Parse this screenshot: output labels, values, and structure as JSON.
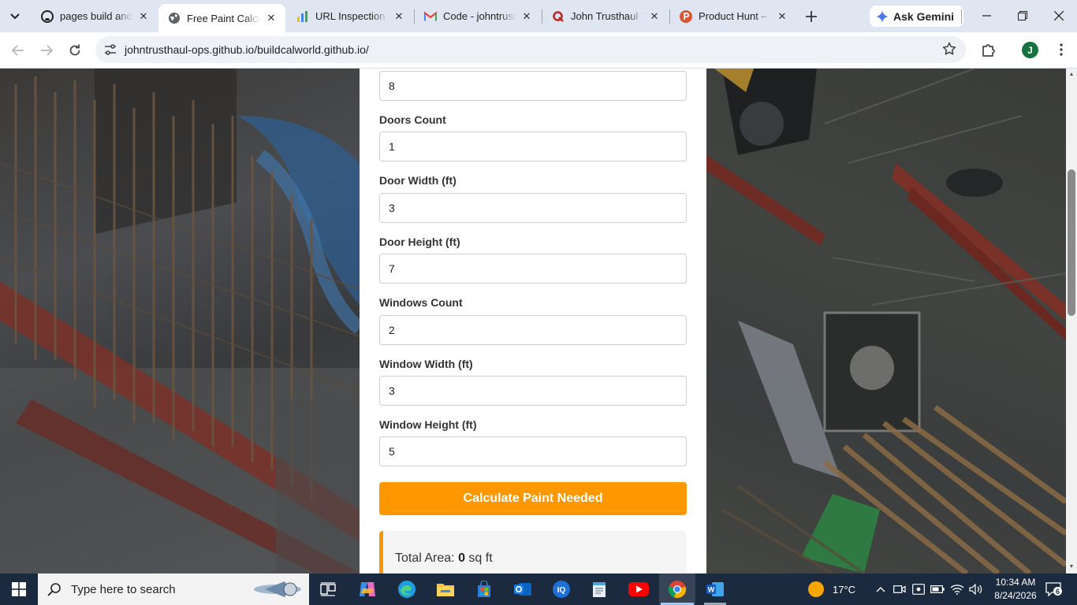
{
  "browser": {
    "tabs": [
      {
        "title": "pages build and d",
        "favicon": "github-icon",
        "active": false
      },
      {
        "title": "Free Paint Calcula",
        "favicon": "globe-icon",
        "active": true
      },
      {
        "title": "URL Inspection",
        "favicon": "search-console-icon",
        "active": false
      },
      {
        "title": "Code - johntrustha",
        "favicon": "gmail-icon",
        "active": false
      },
      {
        "title": "John Trusthaul Tr",
        "favicon": "quora-icon",
        "active": false
      },
      {
        "title": "Product Hunt – T",
        "favicon": "product-hunt-icon",
        "active": false
      }
    ],
    "gemini_label": "Ask Gemini",
    "url": "johntrusthaul-ops.github.io/buildcalworld.github.io/",
    "profile_initial": "J"
  },
  "form": {
    "top_value": "8",
    "fields": [
      {
        "label": "Doors Count",
        "value": "1"
      },
      {
        "label": "Door Width (ft)",
        "value": "3"
      },
      {
        "label": "Door Height (ft)",
        "value": "7"
      },
      {
        "label": "Windows Count",
        "value": "2"
      },
      {
        "label": "Window Width (ft)",
        "value": "3"
      },
      {
        "label": "Window Height (ft)",
        "value": "5"
      }
    ],
    "button_label": "Calculate Paint Needed",
    "result": {
      "label": "Total Area:",
      "value": "0",
      "unit": "sq ft"
    }
  },
  "taskbar": {
    "search_placeholder": "Type here to search",
    "weather": "17°C",
    "time": "10:34 AM",
    "date": "8/24/2026",
    "notification_count": "6"
  },
  "colors": {
    "accent_orange": "#ff9800",
    "tab_strip": "#dfe6f1",
    "taskbar": "#1c2a3f"
  }
}
